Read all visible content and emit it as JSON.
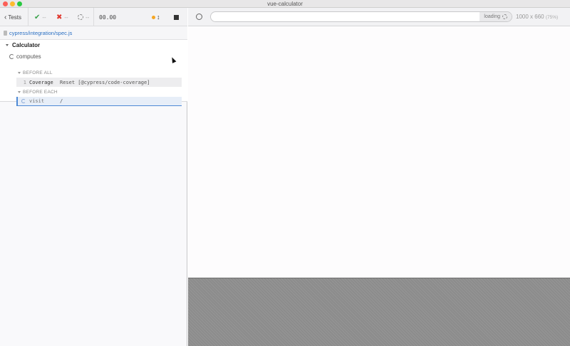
{
  "window": {
    "title": "vue-calculator"
  },
  "toolbar": {
    "back_label": "Tests",
    "passed": "--",
    "failed": "--",
    "pending": "--",
    "timer": "00.00",
    "autoscroll_icon": "↕",
    "colors": {
      "passed": "#3aa24b",
      "failed": "#e0382f",
      "orange": "#f5a623"
    }
  },
  "spec": {
    "path": "cypress/integration/spec.js"
  },
  "suite": {
    "title": "Calculator"
  },
  "test": {
    "title": "computes"
  },
  "hooks": {
    "before_all": {
      "label": "BEFORE ALL",
      "commands": [
        {
          "num": "1",
          "name": "Coverage",
          "message": "Reset [@cypress/code-coverage]"
        }
      ]
    },
    "before_each": {
      "label": "BEFORE EACH",
      "commands": [
        {
          "name": "visit",
          "message": "/"
        }
      ]
    }
  },
  "url_bar": {
    "value": "",
    "loading_label": "loading"
  },
  "viewport": {
    "size": "1000 x 660",
    "scale": "(75%)"
  }
}
